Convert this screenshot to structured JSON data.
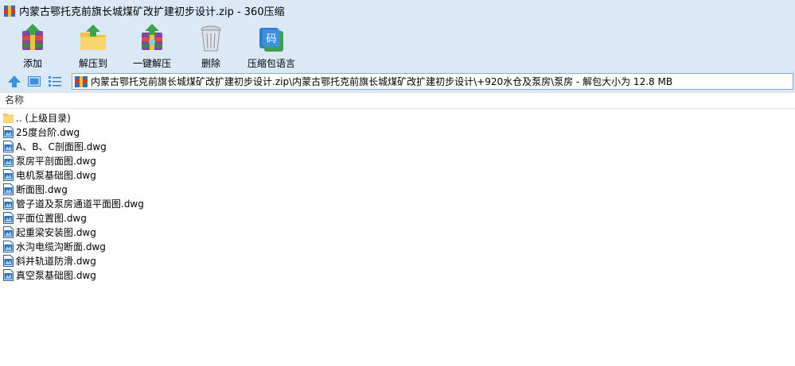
{
  "window": {
    "title": "内蒙古鄂托克前旗长城煤矿改扩建初步设计.zip - 360压缩"
  },
  "toolbar": {
    "buttons": [
      {
        "label": "添加",
        "icon": "add-archive-icon"
      },
      {
        "label": "解压到",
        "icon": "extract-to-icon"
      },
      {
        "label": "一键解压",
        "icon": "one-click-extract-icon"
      },
      {
        "label": "删除",
        "icon": "delete-trash-icon"
      },
      {
        "label": "压缩包语言",
        "icon": "archive-language-icon"
      }
    ]
  },
  "navbar": {
    "path": "内蒙古鄂托克前旗长城煤矿改扩建初步设计.zip\\内蒙古鄂托克前旗长城煤矿改扩建初步设计\\+920水仓及泵房\\泵房 - 解包大小为 12.8 MB"
  },
  "filelist": {
    "column_name": "名称",
    "items": [
      {
        "name": ".. (上级目录)",
        "type": "folder"
      },
      {
        "name": "25度台阶.dwg",
        "type": "dwg"
      },
      {
        "name": "A、B、C剖面图.dwg",
        "type": "dwg"
      },
      {
        "name": "泵房平剖面图.dwg",
        "type": "dwg"
      },
      {
        "name": "电机泵基础图.dwg",
        "type": "dwg"
      },
      {
        "name": "断面图.dwg",
        "type": "dwg"
      },
      {
        "name": "管子道及泵房通道平面图.dwg",
        "type": "dwg"
      },
      {
        "name": "平面位置图.dwg",
        "type": "dwg"
      },
      {
        "name": "起重梁安装图.dwg",
        "type": "dwg"
      },
      {
        "name": "水沟电缆沟断面.dwg",
        "type": "dwg"
      },
      {
        "name": "斜井轨道防滑.dwg",
        "type": "dwg"
      },
      {
        "name": "真空泵基础图.dwg",
        "type": "dwg"
      }
    ]
  }
}
